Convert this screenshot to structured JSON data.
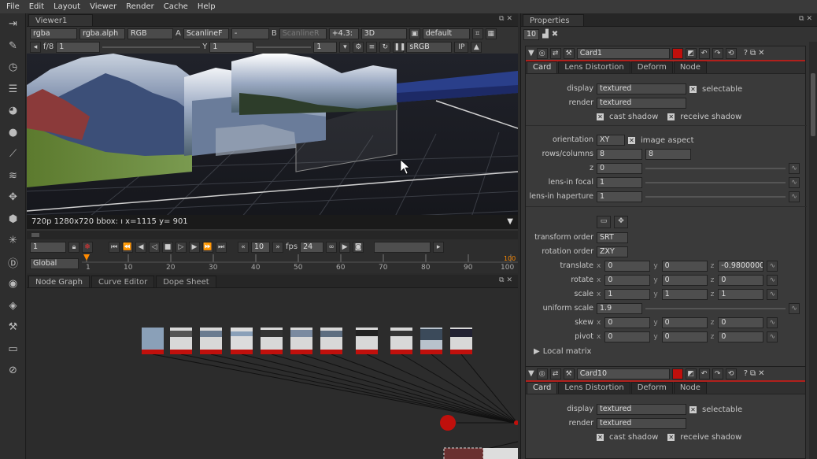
{
  "menu": [
    "File",
    "Edit",
    "Layout",
    "Viewer",
    "Render",
    "Cache",
    "Help"
  ],
  "toolbar_icons": [
    "import-icon",
    "paint-icon",
    "time-icon",
    "channel-icon",
    "color-icon",
    "filter-icon",
    "keyer-icon",
    "merge-icon",
    "transform-icon",
    "3d-icon",
    "particles-icon",
    "deep-icon",
    "views-icon",
    "metadata-icon",
    "toolsets-icon",
    "other-icon",
    "furnace-icon"
  ],
  "viewer": {
    "tab": "Viewer1",
    "row1": {
      "channels": "rgba",
      "alpha": "rgba.alph",
      "display": "RGB",
      "a_label": "A",
      "a_input": "ScanlineF",
      "dash": "-",
      "b_label": "B",
      "b_input": "ScanlineR",
      "gain": "+4.3:",
      "mode": "3D",
      "lut": "default"
    },
    "row2": {
      "fstop": "f/8",
      "gain_val": "1",
      "y_label": "Y",
      "gamma_val": "1",
      "frame": "1",
      "colorspace": "sRGB",
      "ip": "IP"
    },
    "format_label": "720p",
    "info": "720p 1280x720 bbox: ı x=1115 y= 901"
  },
  "timeline": {
    "frame": "1",
    "step": "10",
    "fps_label": "fps",
    "fps": "24",
    "range": "Global",
    "end_frame": "100",
    "ticks": [
      "1",
      "10",
      "20",
      "30",
      "40",
      "50",
      "60",
      "70",
      "80",
      "90",
      "100"
    ]
  },
  "nodegraph": {
    "tabs": [
      "Node Graph",
      "Curve Editor",
      "Dope Sheet"
    ]
  },
  "properties": {
    "title": "Properties",
    "max_panels": "10",
    "panels": [
      {
        "name": "Card1",
        "tabs": [
          "Card",
          "Lens Distortion",
          "Deform",
          "Node"
        ],
        "display_label": "display",
        "display": "textured",
        "selectable": "selectable",
        "render_label": "render",
        "render": "textured",
        "cast_shadow": "cast shadow",
        "receive_shadow": "receive shadow",
        "orientation_label": "orientation",
        "orientation": "XY",
        "image_aspect": "image aspect",
        "rows_label": "rows/columns",
        "rows": "8",
        "columns": "8",
        "z_label": "z",
        "z": "0",
        "focal_label": "lens-in focal",
        "focal": "1",
        "haperture_label": "lens-in haperture",
        "haperture": "1",
        "transform_order_label": "transform order",
        "transform_order": "SRT",
        "rotation_order_label": "rotation order",
        "rotation_order": "ZXY",
        "translate_label": "translate",
        "translate": [
          "0",
          "0",
          "-0.9800000"
        ],
        "rotate_label": "rotate",
        "rotate": [
          "0",
          "0",
          "0"
        ],
        "scale_label": "scale",
        "scale": [
          "1",
          "1",
          "1"
        ],
        "uniform_label": "uniform scale",
        "uniform": "1.9",
        "skew_label": "skew",
        "skew": [
          "0",
          "0",
          "0"
        ],
        "pivot_label": "pivot",
        "pivot": [
          "0",
          "0",
          "0"
        ],
        "local_matrix": "Local matrix"
      },
      {
        "name": "Card10",
        "tabs": [
          "Card",
          "Lens Distortion",
          "Deform",
          "Node"
        ],
        "display_label": "display",
        "display": "textured",
        "selectable": "selectable",
        "render_label": "render",
        "render": "textured",
        "cast_shadow": "cast shadow",
        "receive_shadow": "receive shadow"
      }
    ]
  },
  "axis_labels": {
    "x": "x",
    "y": "y",
    "z": "z"
  },
  "colors": {
    "accent": "#b0201c",
    "node_red": "#c0100c",
    "playhead": "#ff8a00"
  }
}
